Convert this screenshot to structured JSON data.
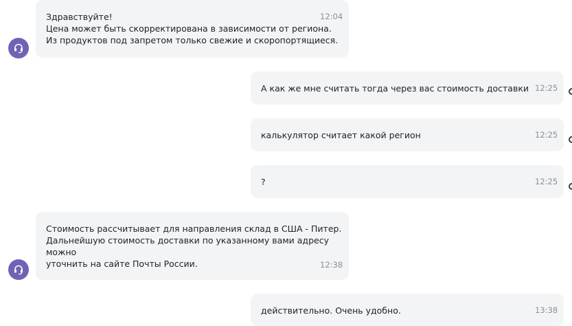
{
  "messages": [
    {
      "sender": "operator",
      "text": "Здравствуйте!\nЦена может быть скорректирована в зависимости от региона.\nИз продуктов под запретом только свежие и скоропортящиеся.",
      "time": "12:04"
    },
    {
      "sender": "user",
      "text": "А как же мне считать тогда через вас стоимость доставки",
      "time": "12:25"
    },
    {
      "sender": "user",
      "text": "калькулятор считает какой регион",
      "time": "12:25"
    },
    {
      "sender": "user",
      "text": "?",
      "time": "12:25"
    },
    {
      "sender": "operator",
      "text": "Стоимость рассчитывает для направления склад в США - Питер.\nДальнейшую стоимость доставки по указанному вами адресу можно\nуточнить на сайте Почты России.",
      "time": "12:38"
    },
    {
      "sender": "user",
      "text": "действительно. Очень удобно.",
      "time": "13:38"
    }
  ],
  "colors": {
    "bubble_bg": "#f3f4f6",
    "operator_avatar": "#6e63b4",
    "timestamp": "#8e8e93"
  },
  "icons": {
    "operator_avatar": "headset-icon"
  }
}
